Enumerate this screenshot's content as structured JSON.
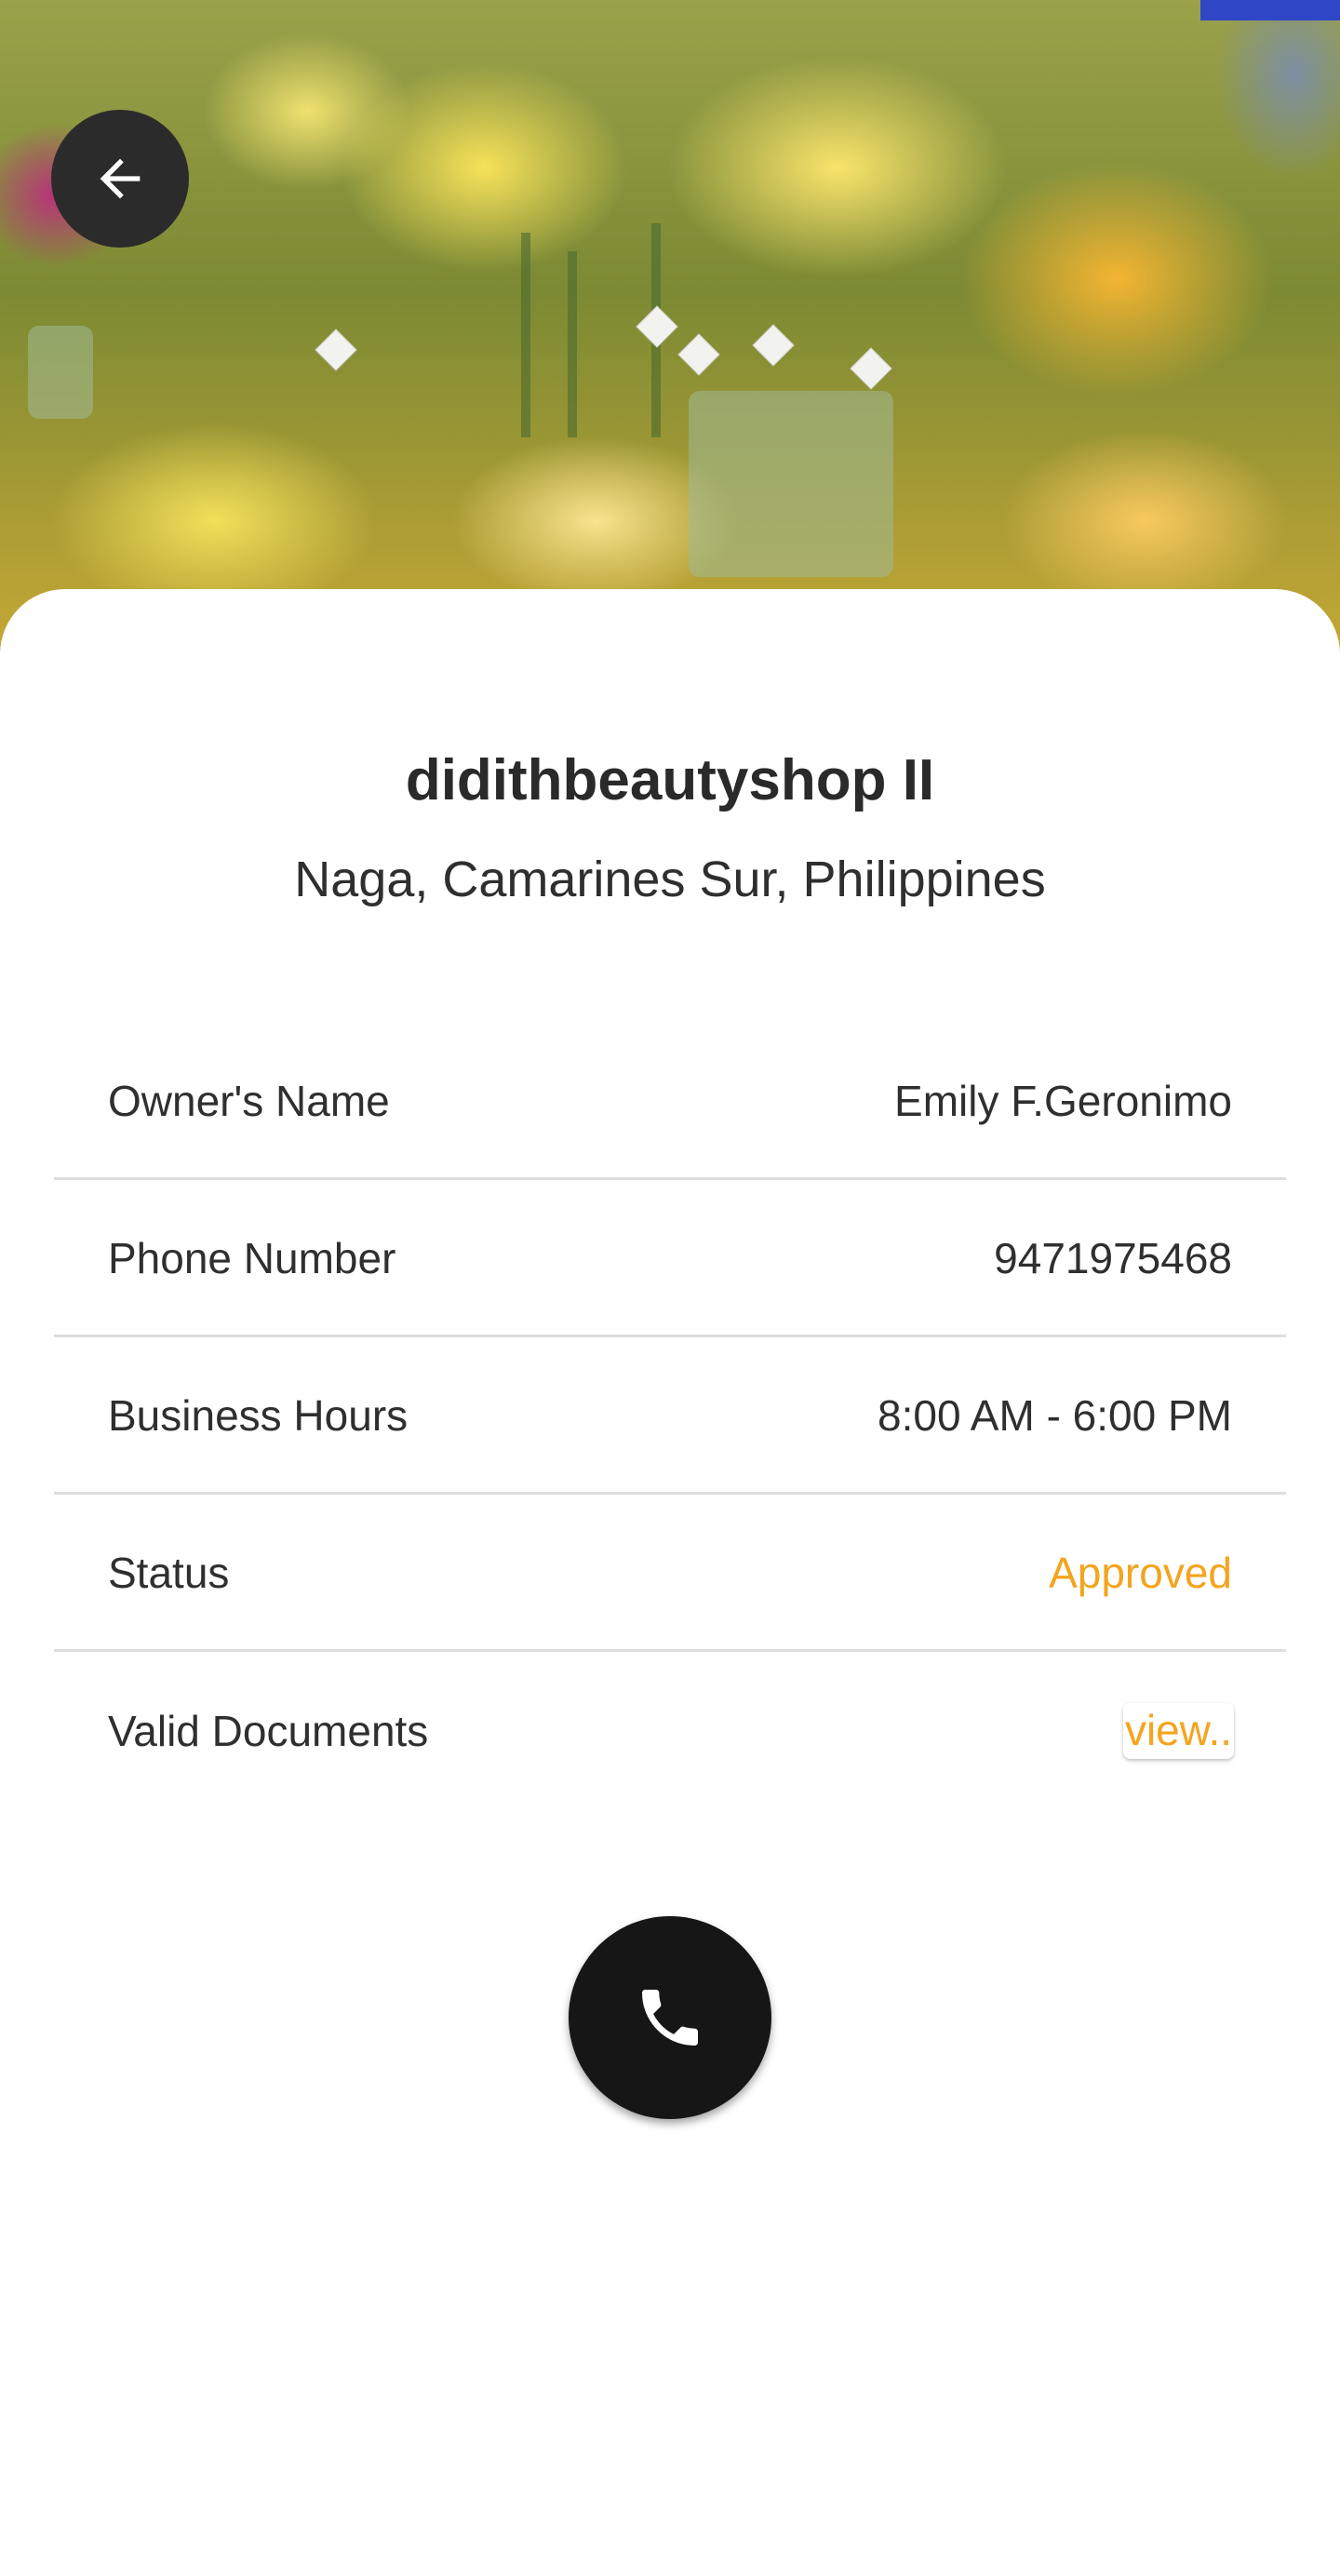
{
  "shop": {
    "name": "didithbeautyshop II",
    "location": "Naga, Camarines Sur, Philippines"
  },
  "details": [
    {
      "label": "Owner's Name",
      "value": "Emily F.Geronimo"
    },
    {
      "label": "Phone Number",
      "value": "9471975468"
    },
    {
      "label": "Business Hours",
      "value": "8:00 AM - 6:00 PM"
    },
    {
      "label": "Status",
      "value": "Approved"
    },
    {
      "label": "Valid Documents",
      "value": "view.."
    }
  ],
  "icons": {
    "back": "arrow-left-icon",
    "call": "phone-icon"
  },
  "colors": {
    "accent": "#f4a41e",
    "call_button": "#161616",
    "back_button": "#2b2b2b"
  }
}
